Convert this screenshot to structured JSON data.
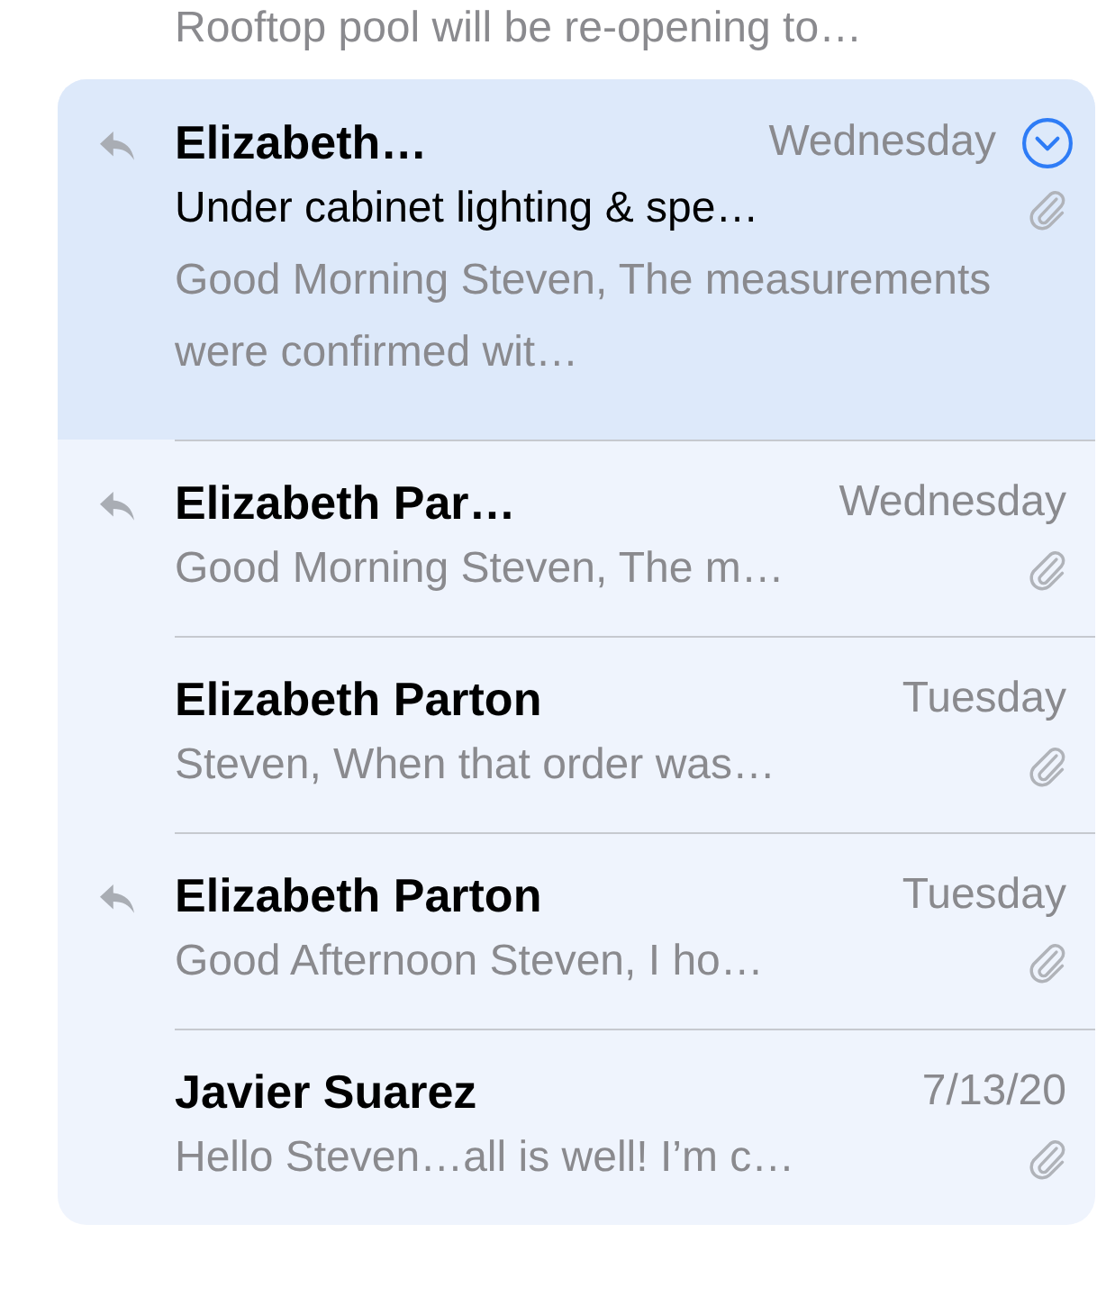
{
  "previous_preview": "Rooftop pool will be re-opening to…",
  "messages": [
    {
      "sender": "Elizabeth…",
      "date": "Wednesday",
      "subject": "Under cabinet lighting & spe…",
      "preview": "Good Morning Steven, The measurements were confirmed wit…",
      "replied": true,
      "attachment": true,
      "selected": true
    },
    {
      "sender": "Elizabeth Par…",
      "date": "Wednesday",
      "preview": "Good Morning Steven, The m…",
      "replied": true,
      "attachment": true,
      "selected": false
    },
    {
      "sender": "Elizabeth Parton",
      "date": "Tuesday",
      "preview": "Steven, When that order was…",
      "replied": false,
      "attachment": true,
      "selected": false
    },
    {
      "sender": "Elizabeth Parton",
      "date": "Tuesday",
      "preview": "Good Afternoon Steven, I ho…",
      "replied": true,
      "attachment": true,
      "selected": false
    },
    {
      "sender": "Javier Suarez",
      "date": "7/13/20",
      "preview": "Hello Steven…all is well! I’m c…",
      "replied": false,
      "attachment": true,
      "selected": false
    }
  ]
}
